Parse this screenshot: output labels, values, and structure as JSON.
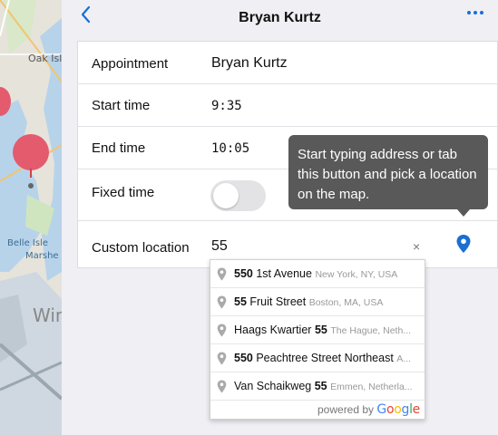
{
  "map": {
    "labels": {
      "oak": "Oak Isl",
      "belle": "Belle Isle",
      "marsh": "Marshe",
      "win": "Win"
    }
  },
  "header": {
    "title": "Bryan Kurtz"
  },
  "form": {
    "appointment_label": "Appointment",
    "appointment_value": "Bryan Kurtz",
    "start_label": "Start time",
    "start_value": "9:35",
    "end_label": "End time",
    "end_value": "10:05",
    "fixed_label": "Fixed time",
    "fixed_value": false,
    "location_label": "Custom location",
    "location_value": "55",
    "clear_symbol": "×"
  },
  "tooltip": {
    "text": "Start typing address or tab this button and pick a location on the map."
  },
  "suggestions": {
    "items": [
      {
        "match": "550",
        "rest": " 1st Avenue",
        "secondary": "New York, NY, USA"
      },
      {
        "match": "55",
        "rest": " Fruit Street",
        "secondary": "Boston, MA, USA"
      },
      {
        "match": "",
        "rest": "Haags Kwartier ",
        "match2": "55",
        "secondary": "The Hague, Neth..."
      },
      {
        "match": "550",
        "rest": " Peachtree Street Northeast",
        "secondary": "A..."
      },
      {
        "match": "",
        "rest": "Van Schaikweg ",
        "match2": "55",
        "secondary": "Emmen, Netherla..."
      }
    ],
    "powered_by": "powered by",
    "google_letters": [
      "G",
      "o",
      "o",
      "g",
      "l",
      "e"
    ]
  },
  "colors": {
    "accent": "#1a6fd1",
    "map_pin": "#e45b6e",
    "tooltip_bg": "#595959",
    "google": [
      "#4285f4",
      "#ea4335",
      "#fbbc05",
      "#4285f4",
      "#34a853",
      "#ea4335"
    ]
  }
}
